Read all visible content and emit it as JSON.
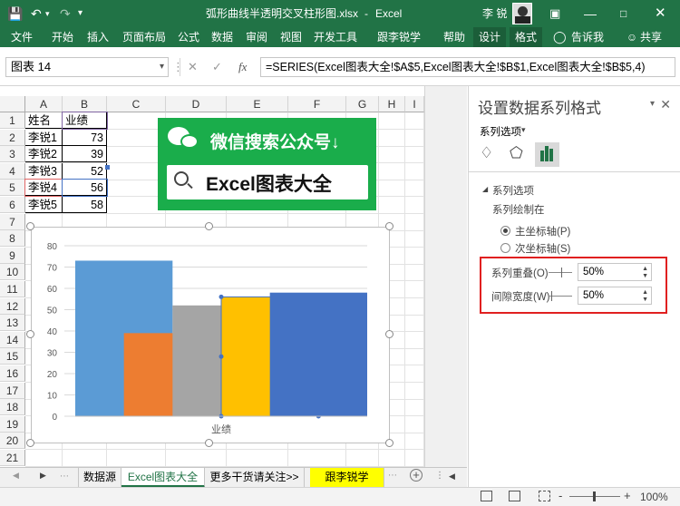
{
  "titlebar": {
    "save_icon": "save-icon",
    "filename": "弧形曲线半透明交叉柱形图.xlsx",
    "separator": "-",
    "app_name": "Excel",
    "user_name": "李 锐"
  },
  "ribbon": {
    "tabs": [
      "文件",
      "开始",
      "插入",
      "页面布局",
      "公式",
      "数据",
      "审阅",
      "视图",
      "开发工具",
      "跟李锐学Excel",
      "帮助",
      "设计",
      "格式"
    ],
    "tell_me": "告诉我",
    "share": "共享"
  },
  "formula_bar": {
    "name_box": "图表 14",
    "fx": "fx",
    "formula": "=SERIES(Excel图表大全!$A$5,Excel图表大全!$B$1,Excel图表大全!$B$5,4)"
  },
  "sheet": {
    "columns": [
      "A",
      "B",
      "C",
      "D",
      "E",
      "F",
      "G",
      "H",
      "I"
    ],
    "rows": [
      "1",
      "2",
      "3",
      "4",
      "5",
      "6",
      "7",
      "8",
      "9",
      "10",
      "11",
      "12",
      "13",
      "14",
      "15",
      "16",
      "17",
      "18",
      "19",
      "20",
      "21",
      "22"
    ],
    "header": [
      "姓名",
      "业绩"
    ],
    "data": [
      [
        "李锐1",
        "73"
      ],
      [
        "李锐2",
        "39"
      ],
      [
        "李锐3",
        "52"
      ],
      [
        "李锐4",
        "56"
      ],
      [
        "李锐5",
        "58"
      ]
    ]
  },
  "banner": {
    "top_text": "微信搜索公众号↓",
    "search_text": "Excel图表大全",
    "bg_color": "#1aad4b"
  },
  "chart_data": {
    "type": "bar",
    "categories": [
      "业绩"
    ],
    "series": [
      {
        "name": "李锐1",
        "values": [
          73
        ],
        "color": "#5b9bd5"
      },
      {
        "name": "李锐2",
        "values": [
          39
        ],
        "color": "#ed7d31"
      },
      {
        "name": "李锐3",
        "values": [
          52
        ],
        "color": "#a5a5a5"
      },
      {
        "name": "李锐4",
        "values": [
          56
        ],
        "color": "#ffc000"
      },
      {
        "name": "李锐5",
        "values": [
          58
        ],
        "color": "#4472c4"
      }
    ],
    "y_ticks": [
      "0",
      "10",
      "20",
      "30",
      "40",
      "50",
      "60",
      "70",
      "80"
    ],
    "ylim": [
      0,
      80
    ],
    "xlabel": "业绩",
    "grid": true,
    "series_overlap_percent": 50,
    "gap_width_percent": 50
  },
  "sheet_tabs": {
    "tabs": [
      "数据源",
      "Excel图表大全",
      "更多干货请关注>>",
      "跟李锐学Excel"
    ],
    "active_color": "#217346",
    "highlight_color": "#ffff00"
  },
  "statusbar": {
    "zoom": "100%",
    "minus": "-",
    "plus": "+"
  },
  "format_pane": {
    "title": "设置数据系列格式",
    "options_dropdown": "系列选项",
    "section": "系列选项",
    "plot_on_label": "系列绘制在",
    "primary_axis": "主坐标轴(P)",
    "secondary_axis": "次坐标轴(S)",
    "overlap_label": "系列重叠(O)",
    "overlap_value": "50%",
    "gap_label": "间隙宽度(W)",
    "gap_value": "50%"
  }
}
